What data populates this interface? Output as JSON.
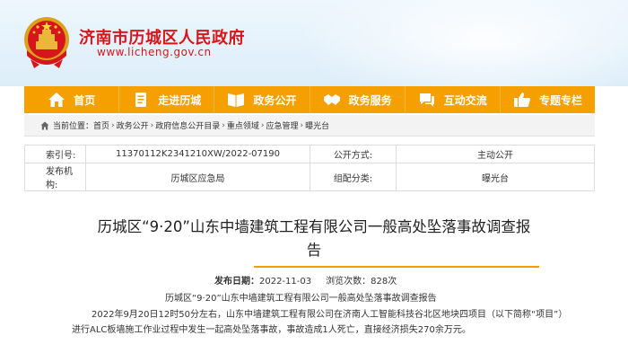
{
  "header": {
    "site_title": "济南市历城区人民政府",
    "site_url": "www.licheng.gov.cn"
  },
  "nav": [
    {
      "label": "首页",
      "icon": "home-icon"
    },
    {
      "label": "走进历城",
      "icon": "document-icon"
    },
    {
      "label": "政务公开",
      "icon": "book-icon"
    },
    {
      "label": "政务服务",
      "icon": "handshake-icon"
    },
    {
      "label": "互动交流",
      "icon": "chat-icon"
    },
    {
      "label": "专题专栏",
      "icon": "like-icon"
    }
  ],
  "breadcrumb": {
    "prefix": "当前位置：",
    "items": [
      "首页",
      "政务公开",
      "政府信息公开目录",
      "重点领域",
      "应急管理",
      "曝光台"
    ]
  },
  "info": {
    "index_label": "索引号:",
    "index_value": "11370112K2341210XW/2022-07190",
    "method_label": "公开方式:",
    "method_value": "主动公开",
    "publisher_label": "发布机构:",
    "publisher_value": "历城区应急局",
    "category_label": "组配分类:",
    "category_value": "曝光台"
  },
  "article": {
    "title_line1": "历城区“9·20”山东中墙建筑工程有限公司一般高处坠落事故调查报",
    "title_line2": "告",
    "date_label": "发布日期：",
    "date_value": "2022-11-03",
    "views_label": "浏览次数：",
    "views_value": "828次",
    "para1": "历城区“9·20”山东中墙建筑工程有限公司一般高处坠落事故调查报告",
    "para2": "2022年9月20日12时50分左右，山东中墙建筑工程有限公司在济南人工智能科技谷北区地块四项目（以下简称“项目”）进行ALC板墙施工作业过程中发生一起高处坠落事故，事故造成1人死亡，直接经济损失270余万元。"
  },
  "colors": {
    "brand_red": "#d6161a",
    "nav_orange": "#f5a000"
  }
}
